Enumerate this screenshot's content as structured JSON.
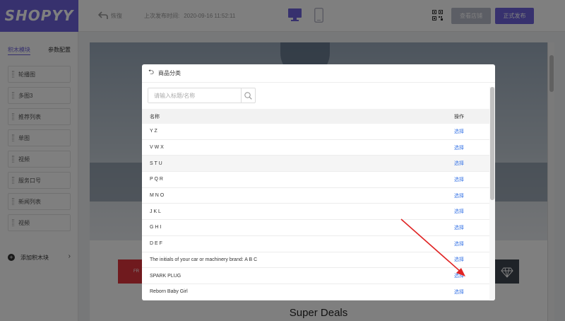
{
  "header": {
    "logo": "SHOPYY",
    "undo_label": "恢復",
    "publish_time_label": "上次发布时间:",
    "publish_time_value": "2020-09-16 11:52:11",
    "view_store_label": "查看店铺",
    "publish_label": "正式发布",
    "accent_color": "#6e63dd"
  },
  "sidebar": {
    "tab_blocks": "积木模块",
    "tab_params": "参数配置",
    "items": [
      {
        "label": "轮播图"
      },
      {
        "label": "多图3"
      },
      {
        "label": "推荐列表"
      },
      {
        "label": "单图"
      },
      {
        "label": "视频"
      },
      {
        "label": "服务口号"
      },
      {
        "label": "新闻列表"
      },
      {
        "label": "视频"
      }
    ],
    "add_block_label": "添加积木块"
  },
  "preview": {
    "promo_text": "FR",
    "super_deals": "Super Deals"
  },
  "modal": {
    "title": "商品分类",
    "search_placeholder": "请输入标题/名称",
    "col_name": "名称",
    "col_op": "操作",
    "rows": [
      {
        "name": "Y Z",
        "op": "选择"
      },
      {
        "name": "V W X",
        "op": "选择"
      },
      {
        "name": "S T U",
        "op": "选择"
      },
      {
        "name": "P Q R",
        "op": "选择"
      },
      {
        "name": "M N O",
        "op": "选择"
      },
      {
        "name": "J K L",
        "op": "选择"
      },
      {
        "name": "G H I",
        "op": "选择"
      },
      {
        "name": "D E F",
        "op": "选择"
      },
      {
        "name": "The initials of your car or machinery brand: A B C",
        "op": "选择"
      },
      {
        "name": "SPARK PLUG",
        "op": "选择"
      },
      {
        "name": "Reborn Baby Girl",
        "op": "选择"
      }
    ],
    "link_color": "#3a76e6"
  }
}
